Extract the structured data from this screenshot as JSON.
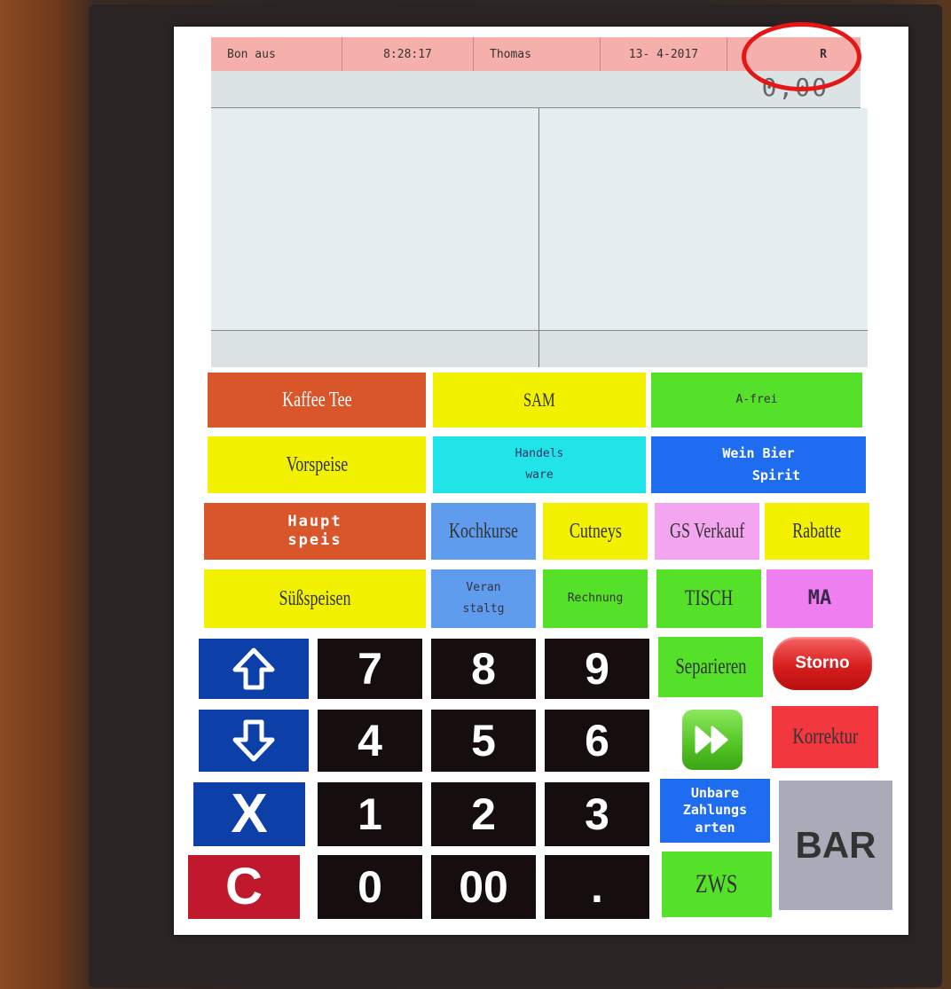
{
  "status_bar": {
    "bon": "Bon aus",
    "time": "8:28:17",
    "user": "Thomas",
    "date": "13- 4-2017",
    "mode": "R"
  },
  "total": "0,00",
  "categories": {
    "kaffee_tee": "Kaffee Tee",
    "sam": "SAM",
    "a_frei": "A-frei",
    "vorspeise": "Vorspeise",
    "handels_1": "Handels",
    "handels_2": "ware",
    "wein_1": "Wein Bier",
    "wein_2": "Spirit",
    "haupt_1": "Haupt",
    "haupt_2": "speis",
    "kochkurse": "Kochkurse",
    "cutneys": "Cutneys",
    "gs_verkauf": "GS Verkauf",
    "rabatte": "Rabatte",
    "suessspeisen": "Süßspeisen",
    "veran_1": "Veran",
    "veran_2": "staltg",
    "rechnung": "Rechnung",
    "tisch": "TISCH",
    "ma": "MA"
  },
  "keypad": {
    "k7": "7",
    "k8": "8",
    "k9": "9",
    "k4": "4",
    "k5": "5",
    "k6": "6",
    "k1": "1",
    "k2": "2",
    "k3": "3",
    "k0": "0",
    "k00": "00",
    "dot": ".",
    "x": "X",
    "c": "C"
  },
  "functions": {
    "separieren": "Separieren",
    "storno": "Storno",
    "korrektur": "Korrektur",
    "unbare_1": "Unbare",
    "unbare_2": "Zahlungs",
    "unbare_3": "arten",
    "bar": "BAR",
    "zws": "ZWS"
  },
  "icons": {
    "up": "arrow-up-icon",
    "down": "arrow-down-icon",
    "forward": "fast-forward-icon"
  },
  "colors": {
    "orange": "#d9562b",
    "yellow": "#f2f200",
    "green": "#55e02a",
    "cyan": "#20e4e8",
    "blue": "#1e6cf0",
    "light_blue": "#5f9cee",
    "pink": "#f3a6ef",
    "magenta": "#ef7ef0",
    "navy": "#0d3fa8",
    "red": "#f2373f",
    "gray": "#a9abb8"
  }
}
